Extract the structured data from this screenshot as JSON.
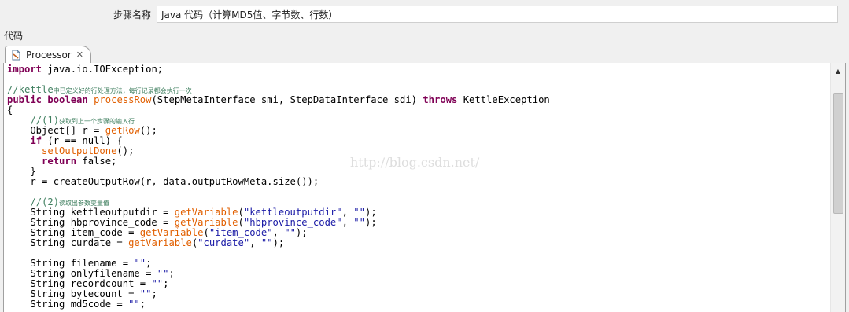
{
  "step_name": {
    "label": "步骤名称",
    "value": "Java 代码（计算MD5值、字节数、行数）"
  },
  "code_section_label": "代码",
  "tab": {
    "label": "Processor",
    "close": "✕",
    "icon": "java-class-icon"
  },
  "watermark": "http://blog.csdn.net/",
  "code_lines": [
    [
      {
        "t": "import",
        "c": "kw"
      },
      {
        "t": " java.io.IOException;"
      }
    ],
    [],
    [
      {
        "t": "//kettle",
        "c": "cm"
      },
      {
        "t": "中已定义好的行处理方法，每行记录都会执行一次",
        "c": "cm cm-small"
      }
    ],
    [
      {
        "t": "public",
        "c": "kw"
      },
      {
        "t": " "
      },
      {
        "t": "boolean",
        "c": "kw"
      },
      {
        "t": " "
      },
      {
        "t": "processRow",
        "c": "fn"
      },
      {
        "t": "(StepMetaInterface smi, StepDataInterface sdi) "
      },
      {
        "t": "throws",
        "c": "kw"
      },
      {
        "t": " KettleException"
      }
    ],
    [
      {
        "t": "{"
      }
    ],
    [
      {
        "t": "    "
      },
      {
        "t": "//(1)",
        "c": "cm"
      },
      {
        "t": "获取到上一个步骤的输入行",
        "c": "cm cm-small"
      }
    ],
    [
      {
        "t": "    Object[] r = "
      },
      {
        "t": "getRow",
        "c": "fn"
      },
      {
        "t": "();"
      }
    ],
    [
      {
        "t": "    "
      },
      {
        "t": "if",
        "c": "kw"
      },
      {
        "t": " (r == null) {"
      }
    ],
    [
      {
        "t": "      "
      },
      {
        "t": "setOutputDone",
        "c": "fn"
      },
      {
        "t": "();"
      }
    ],
    [
      {
        "t": "      "
      },
      {
        "t": "return",
        "c": "kw"
      },
      {
        "t": " false;"
      }
    ],
    [
      {
        "t": "    }"
      }
    ],
    [
      {
        "t": "    r = createOutputRow(r, data.outputRowMeta.size());"
      }
    ],
    [],
    [
      {
        "t": "    "
      },
      {
        "t": "//(2)",
        "c": "cm"
      },
      {
        "t": "读取出参数变量值",
        "c": "cm cm-small"
      }
    ],
    [
      {
        "t": "    String kettleoutputdir = "
      },
      {
        "t": "getVariable",
        "c": "fn"
      },
      {
        "t": "("
      },
      {
        "t": "\"kettleoutputdir\"",
        "c": "str"
      },
      {
        "t": ", "
      },
      {
        "t": "\"\"",
        "c": "str"
      },
      {
        "t": ");"
      }
    ],
    [
      {
        "t": "    String hbprovince_code = "
      },
      {
        "t": "getVariable",
        "c": "fn"
      },
      {
        "t": "("
      },
      {
        "t": "\"hbprovince_code\"",
        "c": "str"
      },
      {
        "t": ", "
      },
      {
        "t": "\"\"",
        "c": "str"
      },
      {
        "t": ");"
      }
    ],
    [
      {
        "t": "    String item_code = "
      },
      {
        "t": "getVariable",
        "c": "fn"
      },
      {
        "t": "("
      },
      {
        "t": "\"item_code\"",
        "c": "str"
      },
      {
        "t": ", "
      },
      {
        "t": "\"\"",
        "c": "str"
      },
      {
        "t": ");"
      }
    ],
    [
      {
        "t": "    String curdate = "
      },
      {
        "t": "getVariable",
        "c": "fn"
      },
      {
        "t": "("
      },
      {
        "t": "\"curdate\"",
        "c": "str"
      },
      {
        "t": ", "
      },
      {
        "t": "\"\"",
        "c": "str"
      },
      {
        "t": ");"
      }
    ],
    [],
    [
      {
        "t": "    String filename = "
      },
      {
        "t": "\"\"",
        "c": "str"
      },
      {
        "t": ";"
      }
    ],
    [
      {
        "t": "    String onlyfilename = "
      },
      {
        "t": "\"\"",
        "c": "str"
      },
      {
        "t": ";"
      }
    ],
    [
      {
        "t": "    String recordcount = "
      },
      {
        "t": "\"\"",
        "c": "str"
      },
      {
        "t": ";"
      }
    ],
    [
      {
        "t": "    String bytecount = "
      },
      {
        "t": "\"\"",
        "c": "str"
      },
      {
        "t": ";"
      }
    ],
    [
      {
        "t": "    String md5code = "
      },
      {
        "t": "\"\"",
        "c": "str"
      },
      {
        "t": ";"
      }
    ]
  ],
  "scrollbar": {
    "position": 0.0
  }
}
